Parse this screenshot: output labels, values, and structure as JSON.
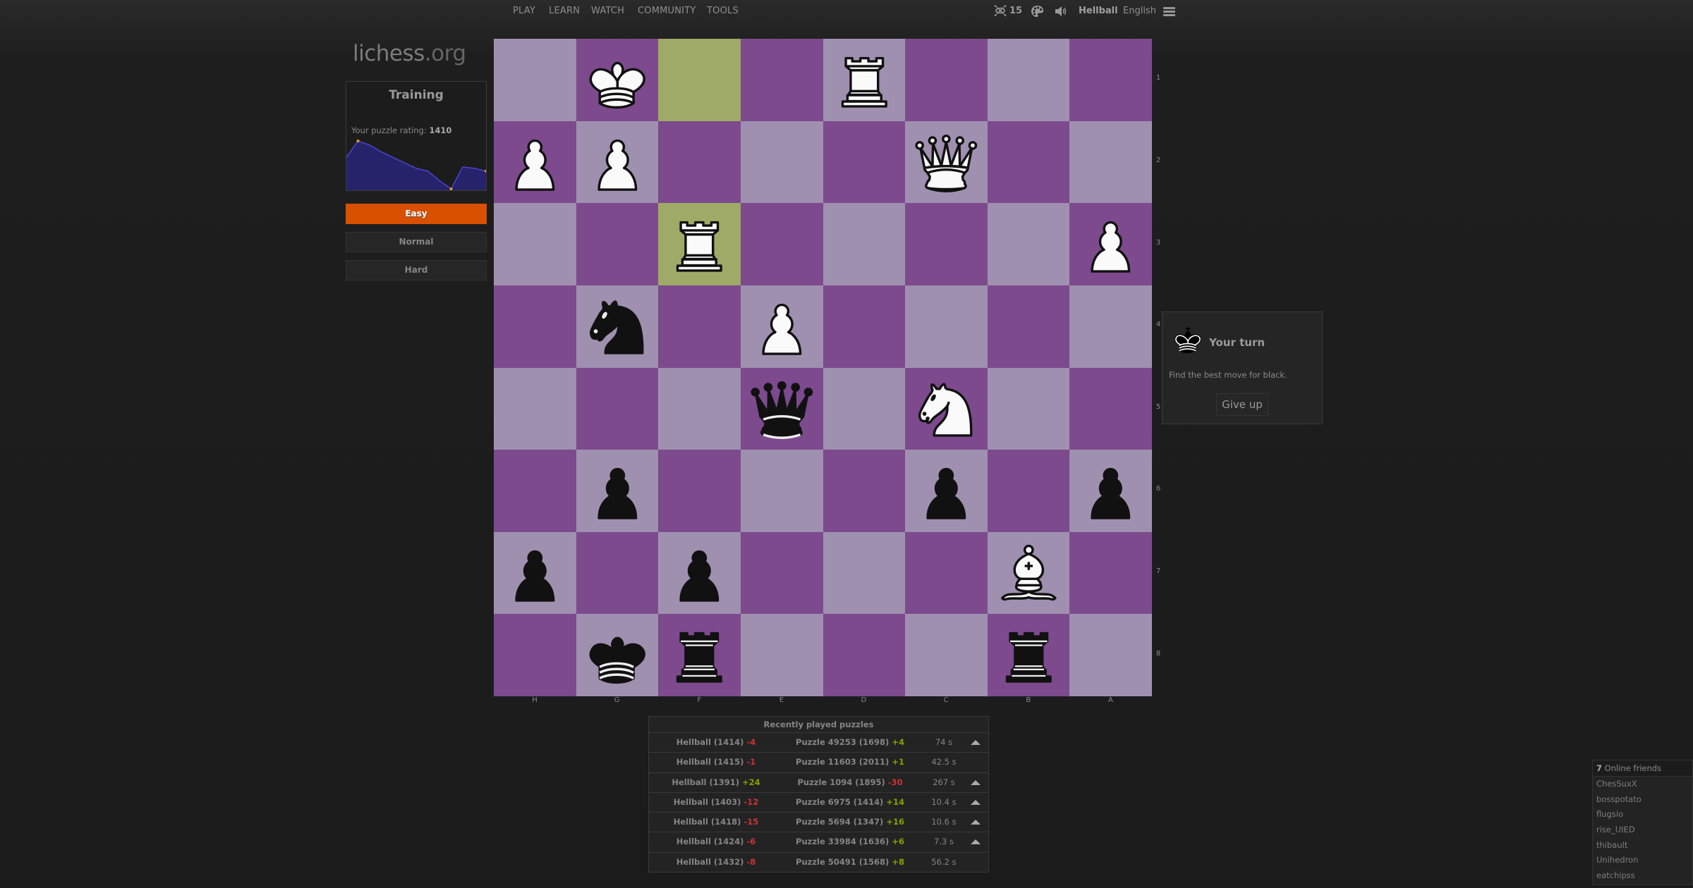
{
  "nav": {
    "links": [
      "PLAY",
      "LEARN",
      "WATCH",
      "COMMUNITY",
      "TOOLS"
    ],
    "watchers_count": "15",
    "username": "Hellball",
    "language": "English",
    "icons": {
      "watchers": "spectators-icon",
      "theme": "palette-icon",
      "sound": "speaker-icon",
      "menu": "hamburger-menu-icon"
    }
  },
  "logo": {
    "name": "lichess",
    "tld": ".org"
  },
  "training": {
    "title": "Training",
    "rating_label": "Your puzzle rating:",
    "rating_value": "1410",
    "difficulty": [
      {
        "label": "Easy",
        "active": true
      },
      {
        "label": "Normal",
        "active": false
      },
      {
        "label": "Hard",
        "active": false
      }
    ],
    "rating_history": [
      1420,
      1432,
      1429,
      1424,
      1420,
      1416,
      1412,
      1410,
      1403,
      1397,
      1413,
      1412,
      1410
    ]
  },
  "board": {
    "orientation": "black",
    "ranks": [
      "1",
      "2",
      "3",
      "4",
      "5",
      "6",
      "7",
      "8"
    ],
    "files": [
      "H",
      "G",
      "F",
      "E",
      "D",
      "C",
      "B",
      "A"
    ],
    "light_color": "#9f90b0",
    "dark_color": "#7d4a8d",
    "highlight_color": "#9eaa66",
    "highlighted_squares": [
      "f1",
      "f3"
    ],
    "pieces": [
      {
        "square": "g1",
        "color": "white",
        "type": "king"
      },
      {
        "square": "d1",
        "color": "white",
        "type": "rook"
      },
      {
        "square": "h2",
        "color": "white",
        "type": "pawn"
      },
      {
        "square": "g2",
        "color": "white",
        "type": "pawn"
      },
      {
        "square": "c2",
        "color": "white",
        "type": "queen"
      },
      {
        "square": "f3",
        "color": "white",
        "type": "rook"
      },
      {
        "square": "a3",
        "color": "white",
        "type": "pawn"
      },
      {
        "square": "g4",
        "color": "black",
        "type": "knight"
      },
      {
        "square": "e4",
        "color": "white",
        "type": "pawn"
      },
      {
        "square": "e5",
        "color": "black",
        "type": "queen"
      },
      {
        "square": "c5",
        "color": "white",
        "type": "knight"
      },
      {
        "square": "g6",
        "color": "black",
        "type": "pawn"
      },
      {
        "square": "c6",
        "color": "black",
        "type": "pawn"
      },
      {
        "square": "a6",
        "color": "black",
        "type": "pawn"
      },
      {
        "square": "h7",
        "color": "black",
        "type": "pawn"
      },
      {
        "square": "f7",
        "color": "black",
        "type": "pawn"
      },
      {
        "square": "b7",
        "color": "white",
        "type": "bishop"
      },
      {
        "square": "g8",
        "color": "black",
        "type": "king"
      },
      {
        "square": "f8",
        "color": "black",
        "type": "rook"
      },
      {
        "square": "b8",
        "color": "black",
        "type": "rook"
      }
    ]
  },
  "turn_panel": {
    "icon": "black-king-icon",
    "title": "Your turn",
    "description": "Find the best move for black.",
    "give_up_label": "Give up"
  },
  "recent_puzzles": {
    "title": "Recently played puzzles",
    "rows": [
      {
        "user": "Hellball (1414)",
        "user_delta": "-4",
        "puzzle": "Puzzle 49253 (1698)",
        "puzzle_delta": "+4",
        "time": "74 s",
        "voted": true
      },
      {
        "user": "Hellball (1415)",
        "user_delta": "-1",
        "puzzle": "Puzzle 11603 (2011)",
        "puzzle_delta": "+1",
        "time": "42.5 s",
        "voted": false
      },
      {
        "user": "Hellball (1391)",
        "user_delta": "+24",
        "puzzle": "Puzzle 1094 (1895)",
        "puzzle_delta": "-30",
        "time": "267 s",
        "voted": true
      },
      {
        "user": "Hellball (1403)",
        "user_delta": "-12",
        "puzzle": "Puzzle 6975 (1414)",
        "puzzle_delta": "+14",
        "time": "10.4 s",
        "voted": true
      },
      {
        "user": "Hellball (1418)",
        "user_delta": "-15",
        "puzzle": "Puzzle 5694 (1347)",
        "puzzle_delta": "+16",
        "time": "10.6 s",
        "voted": true
      },
      {
        "user": "Hellball (1424)",
        "user_delta": "-6",
        "puzzle": "Puzzle 33984 (1636)",
        "puzzle_delta": "+6",
        "time": "7.3 s",
        "voted": true
      },
      {
        "user": "Hellball (1432)",
        "user_delta": "-8",
        "puzzle": "Puzzle 50491 (1568)",
        "puzzle_delta": "+8",
        "time": "56.2 s",
        "voted": false
      }
    ]
  },
  "friends": {
    "count": "7",
    "label": "Online friends",
    "list": [
      "ChesSuxX",
      "bosspotato",
      "flugsio",
      "rise_UIED",
      "thibault",
      "Unihedron",
      "eatchipss"
    ]
  },
  "colors": {
    "accent": "#d85000",
    "positive": "#7fa600",
    "negative": "#cc3333",
    "chart_fill": "#26236a",
    "chart_line": "#4a44d0"
  }
}
